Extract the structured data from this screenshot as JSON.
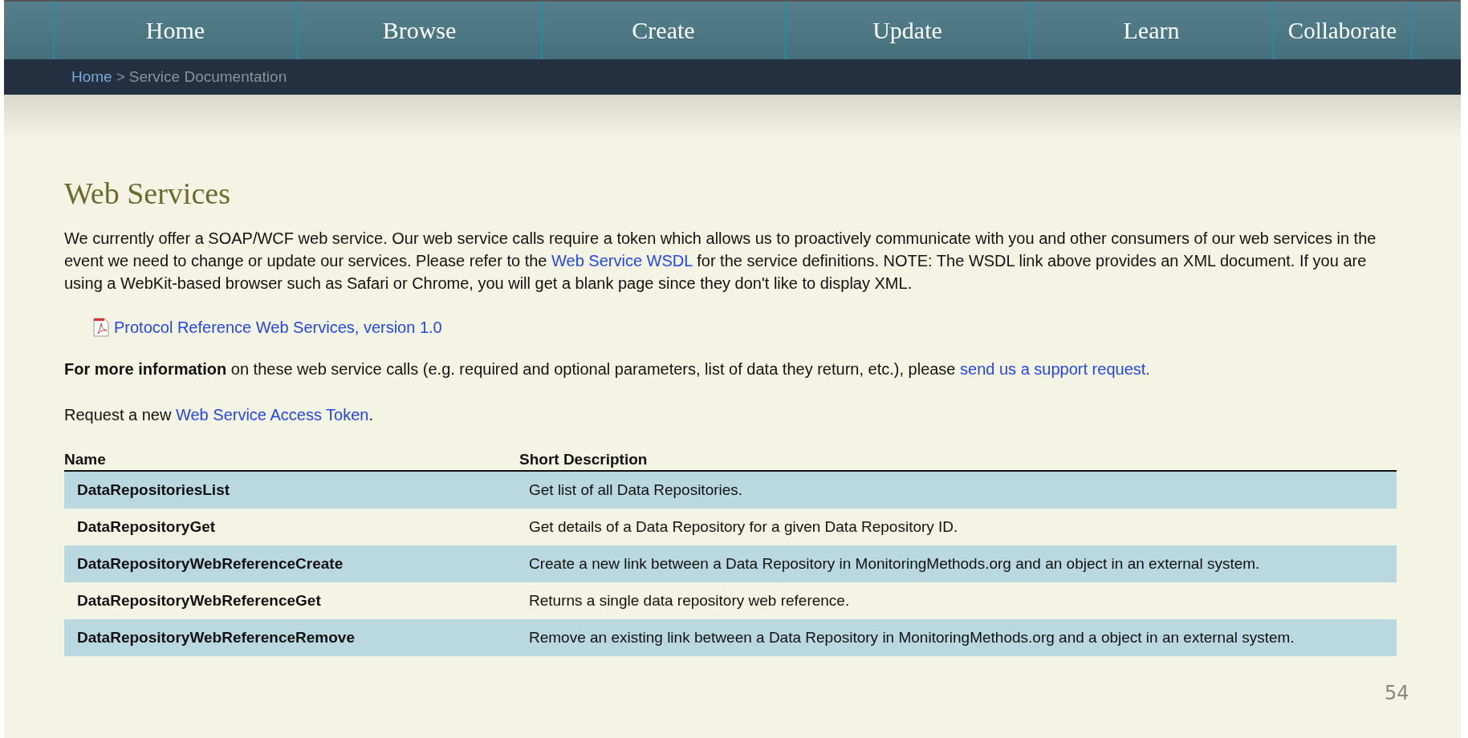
{
  "nav": {
    "tabs": [
      {
        "label": "Home"
      },
      {
        "label": "Browse"
      },
      {
        "label": "Create"
      },
      {
        "label": "Update"
      },
      {
        "label": "Learn"
      },
      {
        "label": "Collaborate"
      }
    ]
  },
  "breadcrumb": [
    {
      "kind": "link",
      "label": "Home"
    },
    {
      "kind": "separator",
      "label": ">"
    },
    {
      "kind": "current",
      "label": "Service Documentation"
    }
  ],
  "heading": "Web Services",
  "intro": [
    {
      "kind": "text",
      "text": "We currently offer a SOAP/WCF web service. Our web service calls require a token which allows us to proactively communicate with you and other consumers of our web services in the event we need to change or update our services. Please refer to the "
    },
    {
      "kind": "link",
      "text": "Web Service WSDL"
    },
    {
      "kind": "text",
      "text": " for the service definitions. NOTE: The WSDL link above provides an XML document. If you are using a WebKit-based browser such as Safari or Chrome, you will get a blank page since they don't like to display XML."
    }
  ],
  "document_link": {
    "label": "Protocol Reference Web Services, version 1.0"
  },
  "more_info": [
    {
      "kind": "text",
      "text": "**For more information** on these web service calls (e.g. required and optional parameters, list of data they return, etc.), please "
    },
    {
      "kind": "link",
      "text": "send us a support request."
    }
  ],
  "token_request": [
    {
      "kind": "text",
      "text": "Request a new "
    },
    {
      "kind": "link",
      "text": "Web Service Access Token"
    },
    {
      "kind": "text",
      "text": "."
    }
  ],
  "table": {
    "columns": [
      "Name",
      "Short Description"
    ],
    "rows": [
      {
        "name": "DataRepositoriesList",
        "description": "Get list of all Data Repositories."
      },
      {
        "name": "DataRepositoryGet",
        "description": "Get details of a Data Repository for a given Data Repository ID."
      },
      {
        "name": "DataRepositoryWebReferenceCreate",
        "description": "Create a new link between a Data Repository in MonitoringMethods.org and an object in an external system."
      },
      {
        "name": "DataRepositoryWebReferenceGet",
        "description": "Returns a single data repository web reference."
      },
      {
        "name": "DataRepositoryWebReferenceRemove",
        "description": "Remove an existing link between a Data Repository in MonitoringMethods.org and a object in an external system."
      }
    ]
  },
  "slide_number": "54"
}
